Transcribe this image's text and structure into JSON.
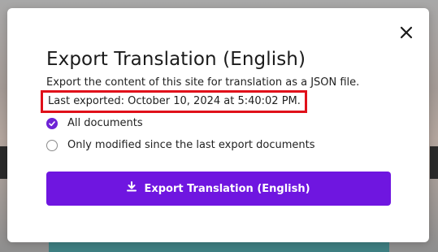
{
  "modal": {
    "title": "Export Translation (English)",
    "description": "Export the content of this site for translation as a JSON file.",
    "last_exported": "Last exported: October 10, 2024 at 5:40:02 PM.",
    "options": [
      {
        "label": "All documents",
        "selected": true
      },
      {
        "label": "Only modified since the last export documents",
        "selected": false
      }
    ],
    "export_button_label": "Export Translation (English)",
    "close_icon": "close-icon",
    "download_icon": "download-icon"
  },
  "colors": {
    "accent": "#6f16e0",
    "highlight_border": "#e0101a"
  }
}
